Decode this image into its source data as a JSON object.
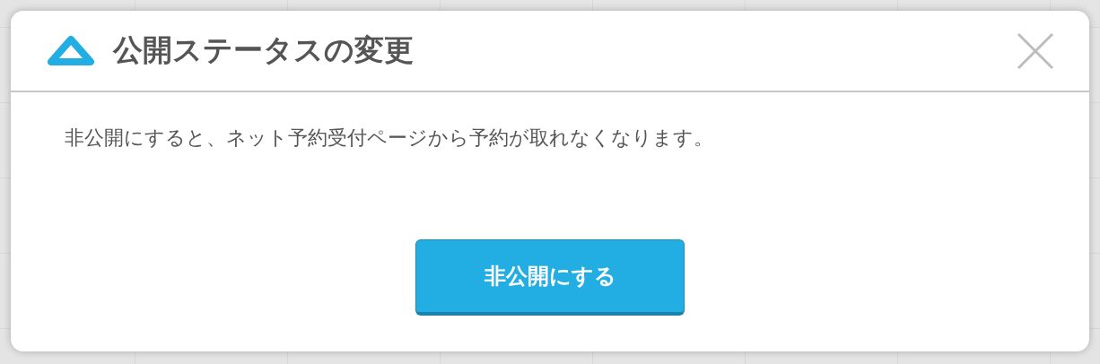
{
  "dialog": {
    "title": "公開ステータスの変更",
    "message": "非公開にすると、ネット予約受付ページから予約が取れなくなります。",
    "confirm_button": "非公開にする"
  }
}
